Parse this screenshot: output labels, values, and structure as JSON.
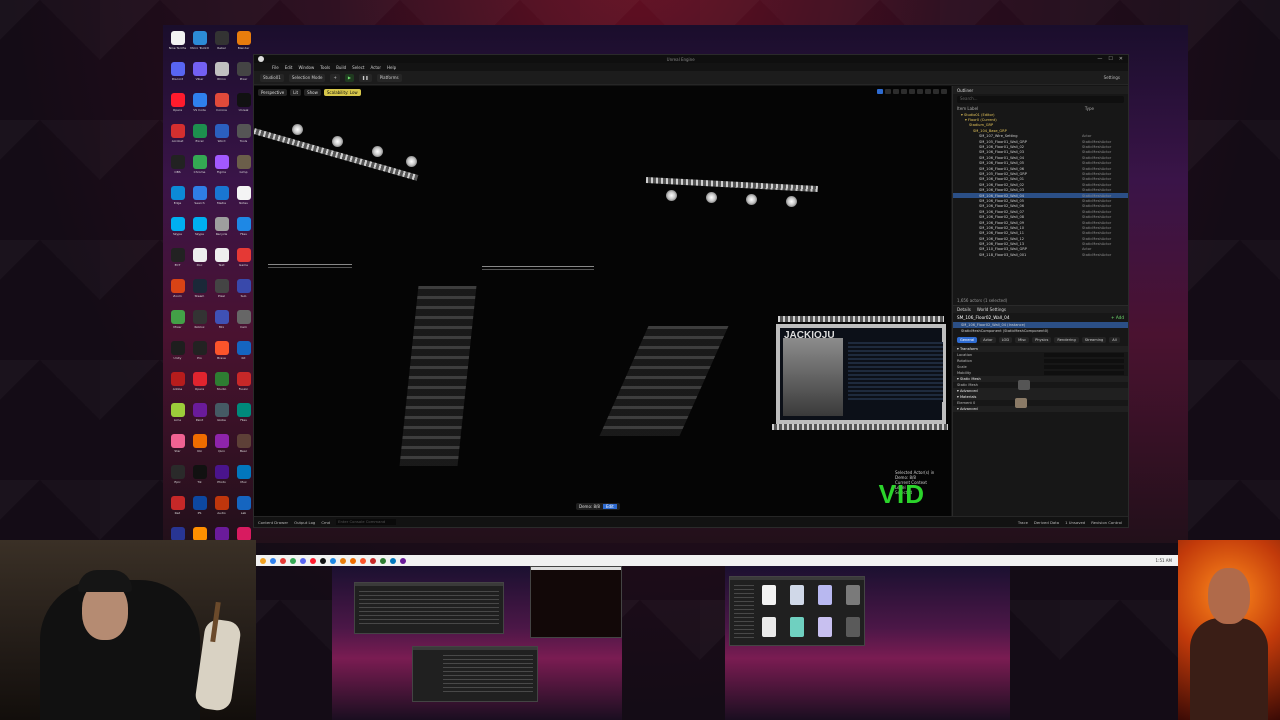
{
  "desktop": {
    "icons": [
      {
        "label": "Nine Tenths",
        "color": "#f2f2f2"
      },
      {
        "label": "Micro Toolkit",
        "color": "#2c8bd6"
      },
      {
        "label": "Rebel",
        "color": "#333333"
      },
      {
        "label": "Blender",
        "color": "#e87d0d"
      },
      {
        "label": "Discord",
        "color": "#5865f2"
      },
      {
        "label": "Viber",
        "color": "#7360f2"
      },
      {
        "label": "Rhino",
        "color": "#c0c0c0"
      },
      {
        "label": "Pixar",
        "color": "#444444"
      },
      {
        "label": "Opera",
        "color": "#ff1b2d"
      },
      {
        "label": "VS Code",
        "color": "#2f80ed"
      },
      {
        "label": "Corona",
        "color": "#e04a3a"
      },
      {
        "label": "Unreal",
        "color": "#111111"
      },
      {
        "label": "Acrobat",
        "color": "#d32f2f"
      },
      {
        "label": "Excel",
        "color": "#1d8f4e"
      },
      {
        "label": "Word",
        "color": "#2b5fbf"
      },
      {
        "label": "Tools",
        "color": "#555555"
      },
      {
        "label": "OBS",
        "color": "#222222"
      },
      {
        "label": "Chrome",
        "color": "#34a853"
      },
      {
        "label": "Figma",
        "color": "#a259ff"
      },
      {
        "label": "Gimp",
        "color": "#6b5e4a"
      },
      {
        "label": "Edge",
        "color": "#0c8ad6"
      },
      {
        "label": "Search",
        "color": "#2f7ee6"
      },
      {
        "label": "Media",
        "color": "#1976d2"
      },
      {
        "label": "Notes",
        "color": "#f4f4f4"
      },
      {
        "label": "Skype",
        "color": "#00aff0"
      },
      {
        "label": "Skype",
        "color": "#00aff0"
      },
      {
        "label": "Recycle",
        "color": "#9e9e9e"
      },
      {
        "label": "Files",
        "color": "#1e88e5"
      },
      {
        "label": "ECT",
        "color": "#222222"
      },
      {
        "label": "Doc",
        "color": "#eeeeee"
      },
      {
        "label": "Text",
        "color": "#eeeeee"
      },
      {
        "label": "Game",
        "color": "#e53935"
      },
      {
        "label": "Zoom",
        "color": "#d84315"
      },
      {
        "label": "Steam",
        "color": "#1b2838"
      },
      {
        "label": "Pixel",
        "color": "#444444"
      },
      {
        "label": "Sub",
        "color": "#3949ab"
      },
      {
        "label": "Mixer",
        "color": "#43a047"
      },
      {
        "label": "Roblox",
        "color": "#333333"
      },
      {
        "label": "Mix",
        "color": "#3f51b5"
      },
      {
        "label": "Cam",
        "color": "#666666"
      },
      {
        "label": "Unity",
        "color": "#1e1e1e"
      },
      {
        "label": "Pro",
        "color": "#222222"
      },
      {
        "label": "Brave",
        "color": "#fb542b"
      },
      {
        "label": "Kit",
        "color": "#1565c0"
      },
      {
        "label": "Adobe",
        "color": "#b71c1c"
      },
      {
        "label": "Opera",
        "color": "#e0242e"
      },
      {
        "label": "Studio",
        "color": "#2e7d32"
      },
      {
        "label": "Fusion",
        "color": "#c62828"
      },
      {
        "label": "Lime",
        "color": "#9ccc3a"
      },
      {
        "label": "Paint",
        "color": "#6a1b9a"
      },
      {
        "label": "Globe",
        "color": "#455a64"
      },
      {
        "label": "Files",
        "color": "#00897b"
      },
      {
        "label": "Star",
        "color": "#f06292"
      },
      {
        "label": "Ubi",
        "color": "#ef6c00"
      },
      {
        "label": "Quix",
        "color": "#8e24aa"
      },
      {
        "label": "Bear",
        "color": "#5d4037"
      },
      {
        "label": "Epic",
        "color": "#2a2a2a"
      },
      {
        "label": "Tik",
        "color": "#111111"
      },
      {
        "label": "Photo",
        "color": "#4a148c"
      },
      {
        "label": "Mux",
        "color": "#0277bd"
      },
      {
        "label": "Red",
        "color": "#c62828"
      },
      {
        "label": "PS",
        "color": "#0d47a1"
      },
      {
        "label": "Audio",
        "color": "#bf360c"
      },
      {
        "label": "Lab",
        "color": "#1565c0"
      },
      {
        "label": "Code",
        "color": "#283593"
      },
      {
        "label": "Wave",
        "color": "#ff8f00"
      },
      {
        "label": "Purple",
        "color": "#6a1b9a"
      },
      {
        "label": "Ani",
        "color": "#d81b60"
      }
    ]
  },
  "editor": {
    "title_right": "Unreal Engine",
    "winctl": [
      "—",
      "☐",
      "✕"
    ],
    "menu": [
      "File",
      "Edit",
      "Window",
      "Tools",
      "Build",
      "Select",
      "Actor",
      "Help"
    ],
    "level_name": "Studio01",
    "toolbar": {
      "mode": "Selection Mode",
      "platforms": "Platforms",
      "settings": "Settings"
    },
    "viewport": {
      "chips": [
        "Perspective",
        "Lit",
        "Show"
      ],
      "warning": "Scalability: Low",
      "overlay_lines": [
        "Selected Actor(s) in",
        "Demo: 8/8",
        "Current Context",
        "Level"
      ],
      "overlay_green": "Selected",
      "big_text": "VID",
      "stat_label": "Demo: 8/8",
      "stat_value": "Edit",
      "screen_title": "JACKIOJU"
    },
    "outliner": {
      "tab": "Outliner",
      "search_placeholder": "Search...",
      "col_label": "Item Label",
      "col_type": "Type",
      "rows": [
        {
          "name": "▾ Studio01 (Editor)",
          "type": "",
          "folder": true
        },
        {
          "name": "▾ Floor0 (Current)",
          "type": "",
          "folder": true
        },
        {
          "name": "Stadium_GRP",
          "type": "",
          "folder": true
        },
        {
          "name": "SM_104_Base_GRP",
          "type": "",
          "folder": true
        },
        {
          "name": "SM_107_Wire_Setting",
          "type": "Actor",
          "folder": false
        },
        {
          "name": "SM_105_Floor01_Wall_GRP",
          "type": "StaticMeshActor",
          "folder": false
        },
        {
          "name": "SM_106_Floor01_Wall_02",
          "type": "StaticMeshActor",
          "folder": false
        },
        {
          "name": "SM_106_Floor01_Wall_03",
          "type": "StaticMeshActor",
          "folder": false
        },
        {
          "name": "SM_106_Floor01_Wall_04",
          "type": "StaticMeshActor",
          "folder": false
        },
        {
          "name": "SM_106_Floor01_Wall_05",
          "type": "StaticMeshActor",
          "folder": false
        },
        {
          "name": "SM_106_Floor01_Wall_06",
          "type": "StaticMeshActor",
          "folder": false
        },
        {
          "name": "SM_105_Floor02_Wall_GRP",
          "type": "StaticMeshActor",
          "folder": false
        },
        {
          "name": "SM_106_Floor02_Wall_01",
          "type": "StaticMeshActor",
          "folder": false
        },
        {
          "name": "SM_106_Floor02_Wall_02",
          "type": "StaticMeshActor",
          "folder": false
        },
        {
          "name": "SM_106_Floor02_Wall_03",
          "type": "StaticMeshActor",
          "folder": false
        },
        {
          "name": "SM_106_Floor02_Wall_04",
          "type": "StaticMeshActor",
          "folder": false,
          "selected": true
        },
        {
          "name": "SM_106_Floor02_Wall_05",
          "type": "StaticMeshActor",
          "folder": false
        },
        {
          "name": "SM_106_Floor02_Wall_06",
          "type": "StaticMeshActor",
          "folder": false
        },
        {
          "name": "SM_106_Floor02_Wall_07",
          "type": "StaticMeshActor",
          "folder": false
        },
        {
          "name": "SM_106_Floor02_Wall_08",
          "type": "StaticMeshActor",
          "folder": false
        },
        {
          "name": "SM_106_Floor02_Wall_09",
          "type": "StaticMeshActor",
          "folder": false
        },
        {
          "name": "SM_106_Floor02_Wall_10",
          "type": "StaticMeshActor",
          "folder": false
        },
        {
          "name": "SM_106_Floor02_Wall_11",
          "type": "StaticMeshActor",
          "folder": false
        },
        {
          "name": "SM_106_Floor02_Wall_12",
          "type": "StaticMeshActor",
          "folder": false
        },
        {
          "name": "SM_106_Floor02_Wall_13",
          "type": "StaticMeshActor",
          "folder": false
        },
        {
          "name": "SM_110_Floor03_Wall_GRP",
          "type": "Actor",
          "folder": false
        },
        {
          "name": "SM_118_Floor03_Wall_001",
          "type": "StaticMeshActor",
          "folder": false
        }
      ],
      "count": "1,656 actors (1 selected)"
    },
    "details": {
      "tabs": [
        "Details",
        "World Settings"
      ],
      "name": "SM_106_Floor02_Wall_04",
      "add": "+ Add",
      "components": [
        {
          "name": "SM_106_Floor02_Wall_04 (Instance)",
          "selected": true
        },
        {
          "name": "StaticMeshComponent (StaticMeshComponent0)",
          "selected": false
        }
      ],
      "filter_tabs": [
        {
          "label": "General",
          "on": true
        },
        {
          "label": "Actor",
          "on": false
        },
        {
          "label": "LOD",
          "on": false
        },
        {
          "label": "Misc",
          "on": false
        },
        {
          "label": "Physics",
          "on": false
        },
        {
          "label": "Rendering",
          "on": false
        },
        {
          "label": "Streaming",
          "on": false
        },
        {
          "label": "All",
          "on": false
        }
      ],
      "props": [
        {
          "label": "▾ Transform",
          "section": true
        },
        {
          "label": "Location",
          "section": false
        },
        {
          "label": "Rotation",
          "section": false
        },
        {
          "label": "Scale",
          "section": false
        },
        {
          "label": "Mobility",
          "section": false
        },
        {
          "label": "▾ Static Mesh",
          "section": true
        },
        {
          "label": "Static Mesh",
          "section": false,
          "thumb": "#555555"
        },
        {
          "label": "▾ Advanced",
          "section": true
        },
        {
          "label": "▾ Materials",
          "section": true
        },
        {
          "label": "Element 0",
          "section": false,
          "thumb": "#8a7a66"
        },
        {
          "label": "▾ Advanced",
          "section": true
        }
      ]
    },
    "status": {
      "items": [
        "Content Drawer",
        "Output Log",
        "Cmd"
      ],
      "cmd_placeholder": "Enter Console Command",
      "right": [
        "Trace",
        "Derived Data",
        "1 Unsaved",
        "Revision Control"
      ]
    }
  },
  "taskbar": {
    "clock": "1:51 AM",
    "icon_colors": [
      "#f0a020",
      "#2f80ed",
      "#e53935",
      "#34a853",
      "#5865f2",
      "#ff1b2d",
      "#111111",
      "#1e88e5",
      "#e87d0d",
      "#ef6c00",
      "#fb542b",
      "#c62828",
      "#2e7d32",
      "#0277bd",
      "#6a1b9a"
    ]
  }
}
